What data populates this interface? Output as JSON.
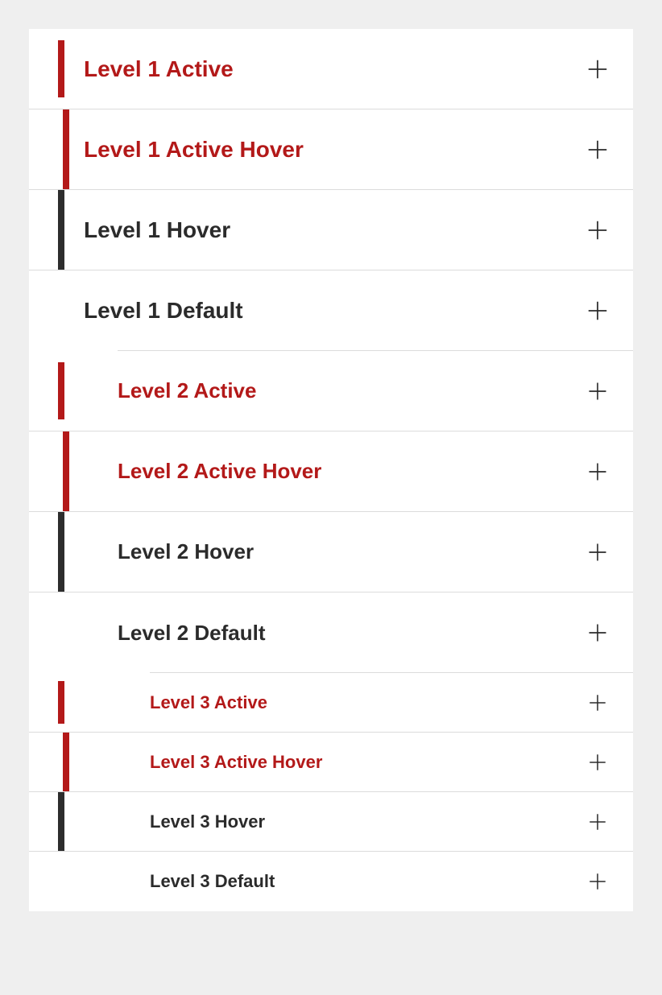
{
  "colors": {
    "accent": "#b31919",
    "hover_bar": "#2d2d2d",
    "text": "#2b2b2b",
    "divider": "#dcdcdc",
    "page_bg": "#efefef",
    "card_bg": "#ffffff"
  },
  "icons": {
    "expand": "plus-icon"
  },
  "menu": {
    "level1": [
      {
        "label": "Level 1 Active",
        "state": "active"
      },
      {
        "label": "Level 1 Active Hover",
        "state": "active-hover"
      },
      {
        "label": "Level 1 Hover",
        "state": "hover"
      },
      {
        "label": "Level 1 Default",
        "state": "default"
      }
    ],
    "level2": [
      {
        "label": "Level 2 Active",
        "state": "active"
      },
      {
        "label": "Level 2 Active Hover",
        "state": "active-hover"
      },
      {
        "label": "Level 2 Hover",
        "state": "hover"
      },
      {
        "label": "Level 2 Default",
        "state": "default"
      }
    ],
    "level3": [
      {
        "label": "Level 3 Active",
        "state": "active"
      },
      {
        "label": "Level 3 Active Hover",
        "state": "active-hover"
      },
      {
        "label": "Level 3 Hover",
        "state": "hover"
      },
      {
        "label": "Level 3 Default",
        "state": "default"
      }
    ]
  }
}
